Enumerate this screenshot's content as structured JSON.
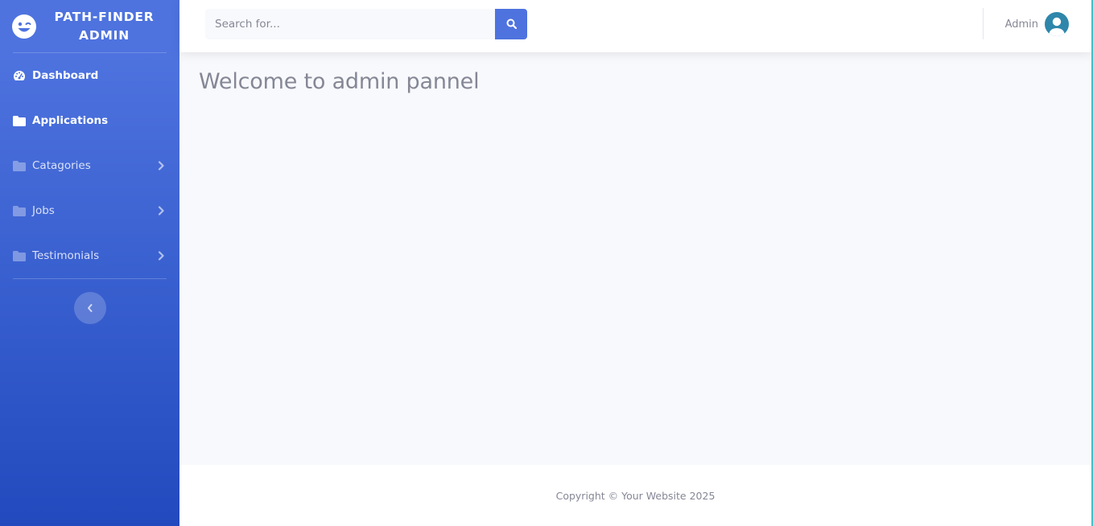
{
  "brand": {
    "name": "PATH-FINDER ADMIN",
    "icon": "laugh-wink-icon"
  },
  "sidebar": {
    "items": [
      {
        "label": "Dashboard",
        "icon": "dashboard-gauge-icon",
        "active": true,
        "expandable": false
      },
      {
        "label": "Applications",
        "icon": "folder-icon",
        "active": true,
        "expandable": false
      },
      {
        "label": "Catagories",
        "icon": "folder-icon",
        "active": false,
        "expandable": true
      },
      {
        "label": "Jobs",
        "icon": "folder-icon",
        "active": false,
        "expandable": true
      },
      {
        "label": "Testimonials",
        "icon": "folder-icon",
        "active": false,
        "expandable": true
      }
    ],
    "toggle_icon": "chevron-left-icon"
  },
  "topbar": {
    "search": {
      "placeholder": "Search for...",
      "value": "",
      "button_icon": "search-icon"
    },
    "user": {
      "name": "Admin",
      "avatar_icon": "user-avatar-icon"
    }
  },
  "main": {
    "title": "Welcome to admin pannel"
  },
  "footer": {
    "text": "Copyright © Your Website 2025"
  },
  "colors": {
    "primary": "#4e73df",
    "primary_dark": "#224abe",
    "text_muted": "#858796",
    "background": "#f8f9fc",
    "avatar": "#2e86ab"
  }
}
